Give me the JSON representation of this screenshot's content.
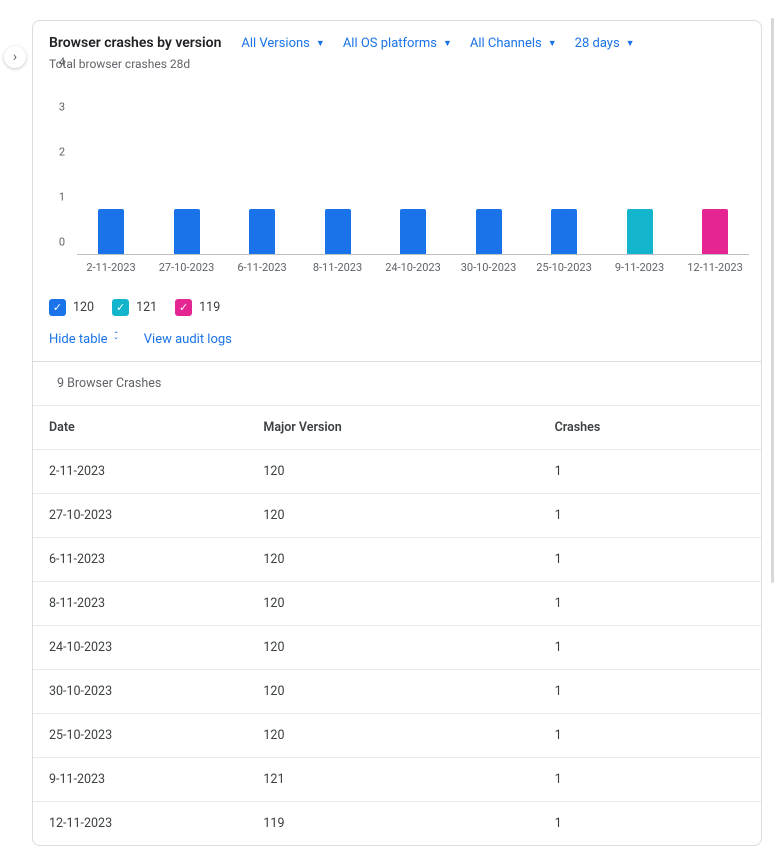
{
  "header": {
    "title": "Browser crashes by version",
    "filters": {
      "versions": "All Versions",
      "os": "All OS platforms",
      "channels": "All Channels",
      "period": "28 days"
    }
  },
  "chart_subtitle": "Total browser crashes 28d",
  "chart_data": {
    "type": "bar",
    "title": "Browser crashes by version",
    "ylabel": "Total browser crashes 28d",
    "ylim": [
      0,
      4
    ],
    "yticks": [
      0,
      1,
      2,
      3,
      4
    ],
    "categories": [
      "2-11-2023",
      "27-10-2023",
      "6-11-2023",
      "8-11-2023",
      "24-10-2023",
      "30-10-2023",
      "25-10-2023",
      "9-11-2023",
      "12-11-2023"
    ],
    "series": [
      {
        "name": "120",
        "color": "#1a73e8",
        "values": [
          1,
          1,
          1,
          1,
          1,
          1,
          1,
          0,
          0
        ]
      },
      {
        "name": "121",
        "color": "#12b5cb",
        "values": [
          0,
          0,
          0,
          0,
          0,
          0,
          0,
          1,
          0
        ]
      },
      {
        "name": "119",
        "color": "#e52592",
        "values": [
          0,
          0,
          0,
          0,
          0,
          0,
          0,
          0,
          1
        ]
      }
    ]
  },
  "legend": [
    {
      "color": "#1a73e8",
      "label": "120"
    },
    {
      "color": "#12b5cb",
      "label": "121"
    },
    {
      "color": "#e52592",
      "label": "119"
    }
  ],
  "actions": {
    "hide_table": "Hide table",
    "view_audit": "View audit logs"
  },
  "table": {
    "caption": "9 Browser Crashes",
    "headers": [
      "Date",
      "Major Version",
      "Crashes"
    ],
    "rows": [
      [
        "2-11-2023",
        "120",
        "1"
      ],
      [
        "27-10-2023",
        "120",
        "1"
      ],
      [
        "6-11-2023",
        "120",
        "1"
      ],
      [
        "8-11-2023",
        "120",
        "1"
      ],
      [
        "24-10-2023",
        "120",
        "1"
      ],
      [
        "30-10-2023",
        "120",
        "1"
      ],
      [
        "25-10-2023",
        "120",
        "1"
      ],
      [
        "9-11-2023",
        "121",
        "1"
      ],
      [
        "12-11-2023",
        "119",
        "1"
      ]
    ]
  }
}
